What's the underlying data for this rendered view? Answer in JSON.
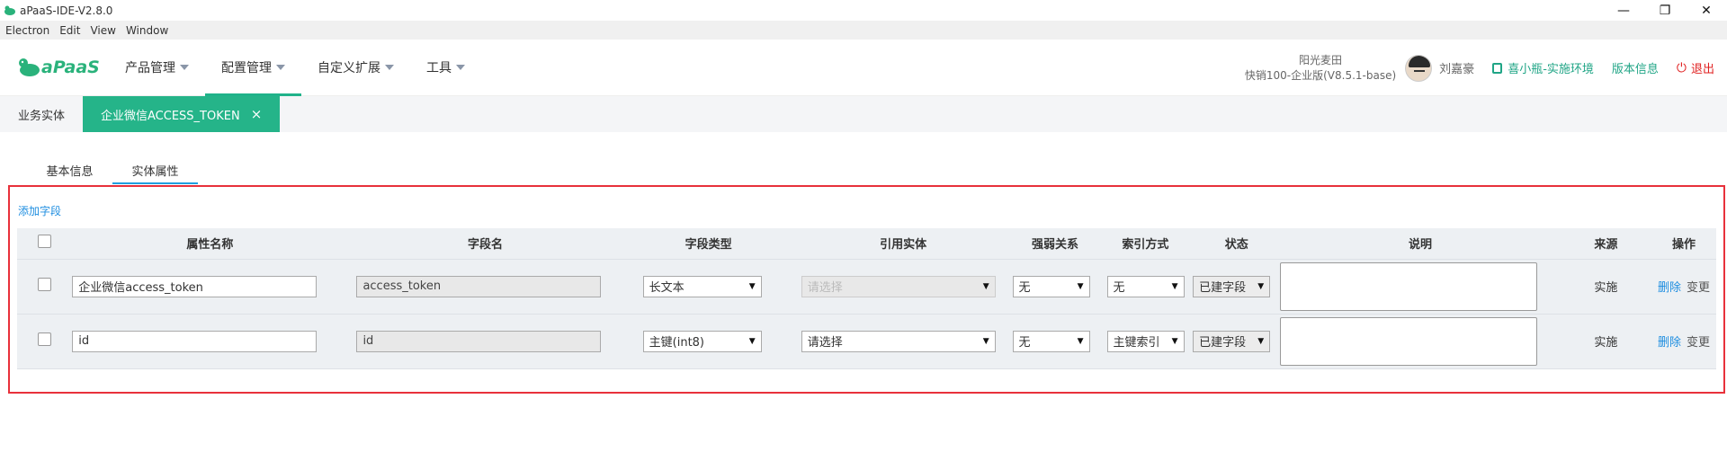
{
  "window": {
    "title": "aPaaS-IDE-V2.8.0",
    "minimize": "—",
    "restore": "❐",
    "close": "✕"
  },
  "menubar": [
    "Electron",
    "Edit",
    "View",
    "Window"
  ],
  "header": {
    "logo": "aPaaS",
    "nav": [
      {
        "label": "产品管理",
        "active": false
      },
      {
        "label": "配置管理",
        "active": true
      },
      {
        "label": "自定义扩展",
        "active": false
      },
      {
        "label": "工具",
        "active": false
      }
    ],
    "company_name": "阳光麦田",
    "company_version": "快销100-企业版(V8.5.1-base)",
    "user_name": "刘嘉豪",
    "env_label": "喜小瓶-实施环境",
    "version_info": "版本信息",
    "logout": "退出",
    "accent": "#20b28a"
  },
  "tabs": [
    {
      "label": "业务实体",
      "active": false
    },
    {
      "label": "企业微信ACCESS_TOKEN",
      "active": true,
      "close": "×"
    }
  ],
  "subtabs": [
    {
      "label": "基本信息",
      "active": false
    },
    {
      "label": "实体属性",
      "active": true
    }
  ],
  "add_field": "添加字段",
  "table": {
    "headers": [
      "属性名称",
      "字段名",
      "字段类型",
      "引用实体",
      "强弱关系",
      "索引方式",
      "状态",
      "说明",
      "来源",
      "操作"
    ],
    "rows": [
      {
        "attr_name": "企业微信access_token",
        "field_name": "access_token",
        "field_type": "长文本",
        "ref_entity": "请选择",
        "relation": "无",
        "index": "无",
        "status": "已建字段",
        "source": "实施",
        "op_delete": "删除",
        "op_change": "变更"
      },
      {
        "attr_name": "id",
        "field_name": "id",
        "field_type": "主键(int8)",
        "ref_entity": "请选择",
        "relation": "无",
        "index": "主键索引",
        "status": "已建字段",
        "source": "实施",
        "op_delete": "删除",
        "op_change": "变更"
      }
    ]
  }
}
